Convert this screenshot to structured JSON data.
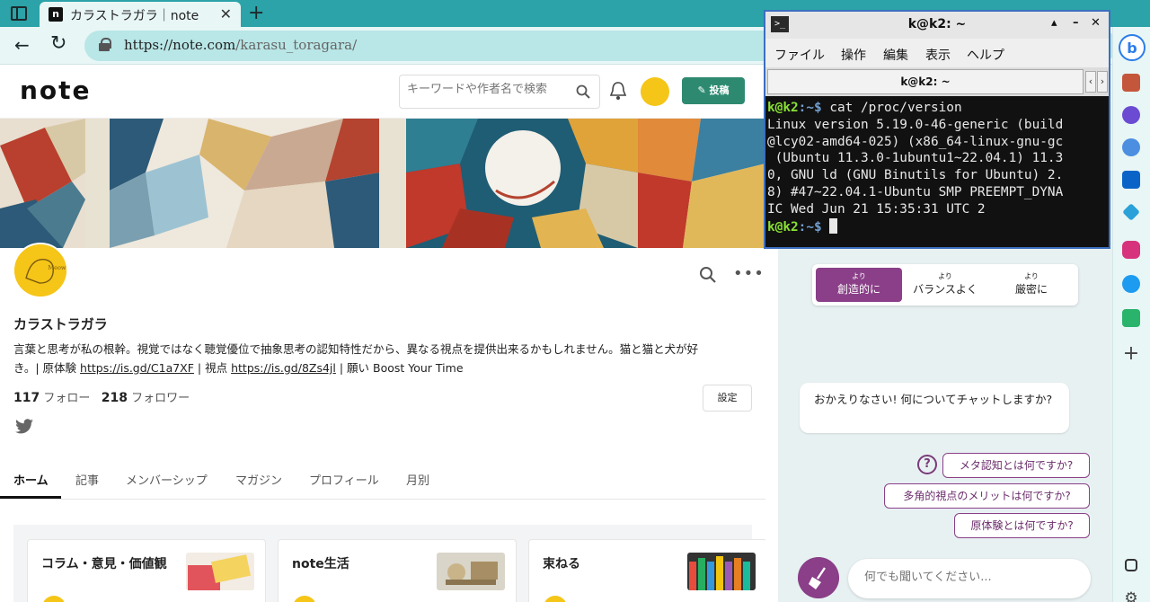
{
  "browser": {
    "tab_title": "カラストラガラ｜note",
    "favicon_letter": "n",
    "url_host": "https://note.com",
    "url_path": "/karasu_toragara/"
  },
  "note": {
    "logo": "note",
    "search_placeholder": "キーワードや作者名で検索",
    "post_button": "投稿",
    "profile": {
      "name": "カラストラガラ",
      "bio_line1": "言葉と思考が私の根幹。視覚ではなく聴覚優位で抽象思考の認知特性だから、異なる視点を提供出来るかもしれません。猫と猫と犬が好",
      "bio_line2_prefix": "き。| 原体験 ",
      "bio_link1": "https://is.gd/C1a7XF",
      "bio_mid": " | 視点 ",
      "bio_link2": "https://is.gd/8Zs4jl",
      "bio_suffix": " | 願い Boost Your Time",
      "follow_count": "117",
      "follow_label": "フォロー",
      "follower_count": "218",
      "follower_label": "フォロワー",
      "settings_button": "設定"
    },
    "tabs": [
      "ホーム",
      "記事",
      "メンバーシップ",
      "マガジン",
      "プロフィール",
      "月別"
    ],
    "magazines": [
      "コラム・意見・価値観",
      "note生活",
      "束ねる"
    ]
  },
  "terminal": {
    "title": "k@k2: ~",
    "menu": [
      "ファイル",
      "操作",
      "編集",
      "表示",
      "ヘルプ"
    ],
    "tab_label": "k@k2: ~",
    "prompt_user": "k@k2",
    "prompt_path": ":~$",
    "command": " cat /proc/version",
    "output": [
      "Linux version 5.19.0-46-generic (build",
      "@lcy02-amd64-025) (x86_64-linux-gnu-gc",
      " (Ubuntu 11.3.0-1ubuntu1~22.04.1) 11.3",
      "0, GNU ld (GNU Binutils for Ubuntu) 2.",
      "8) #47~22.04.1-Ubuntu SMP PREEMPT_DYNA",
      "IC Wed Jun 21 15:35:31 UTC 2"
    ]
  },
  "copilot": {
    "modes": [
      {
        "small": "より",
        "label": "創造的に"
      },
      {
        "small": "より",
        "label": "バランスよく"
      },
      {
        "small": "より",
        "label": "厳密に"
      }
    ],
    "greeting": "おかえりなさい! 何についてチャットしますか?",
    "help_glyph": "?",
    "suggestions": [
      "メタ認知とは何ですか?",
      "多角的視点のメリットは何ですか?",
      "原体験とは何ですか?"
    ],
    "input_placeholder": "何でも聞いてください..."
  },
  "colors": {
    "browser_accent": "#2ba3a8",
    "note_green": "#2d8a71",
    "copilot_purple": "#8a3f88",
    "terminal_bg": "#111111",
    "prompt_green": "#8ae234",
    "prompt_blue": "#729fcf"
  },
  "icons": [
    "sidebar-toggle-icon",
    "back-icon",
    "reload-icon",
    "lock-icon",
    "search-icon",
    "bell-icon",
    "pencil-icon",
    "more-icon",
    "twitter-icon",
    "help-icon",
    "broom-icon",
    "bing-icon",
    "briefcase-icon",
    "shapes-icon",
    "copilot-icon",
    "outlook-icon",
    "send-icon",
    "instagram-icon",
    "twitter-icon",
    "notebook-icon",
    "plus-icon",
    "layout-icon",
    "gear-icon"
  ]
}
